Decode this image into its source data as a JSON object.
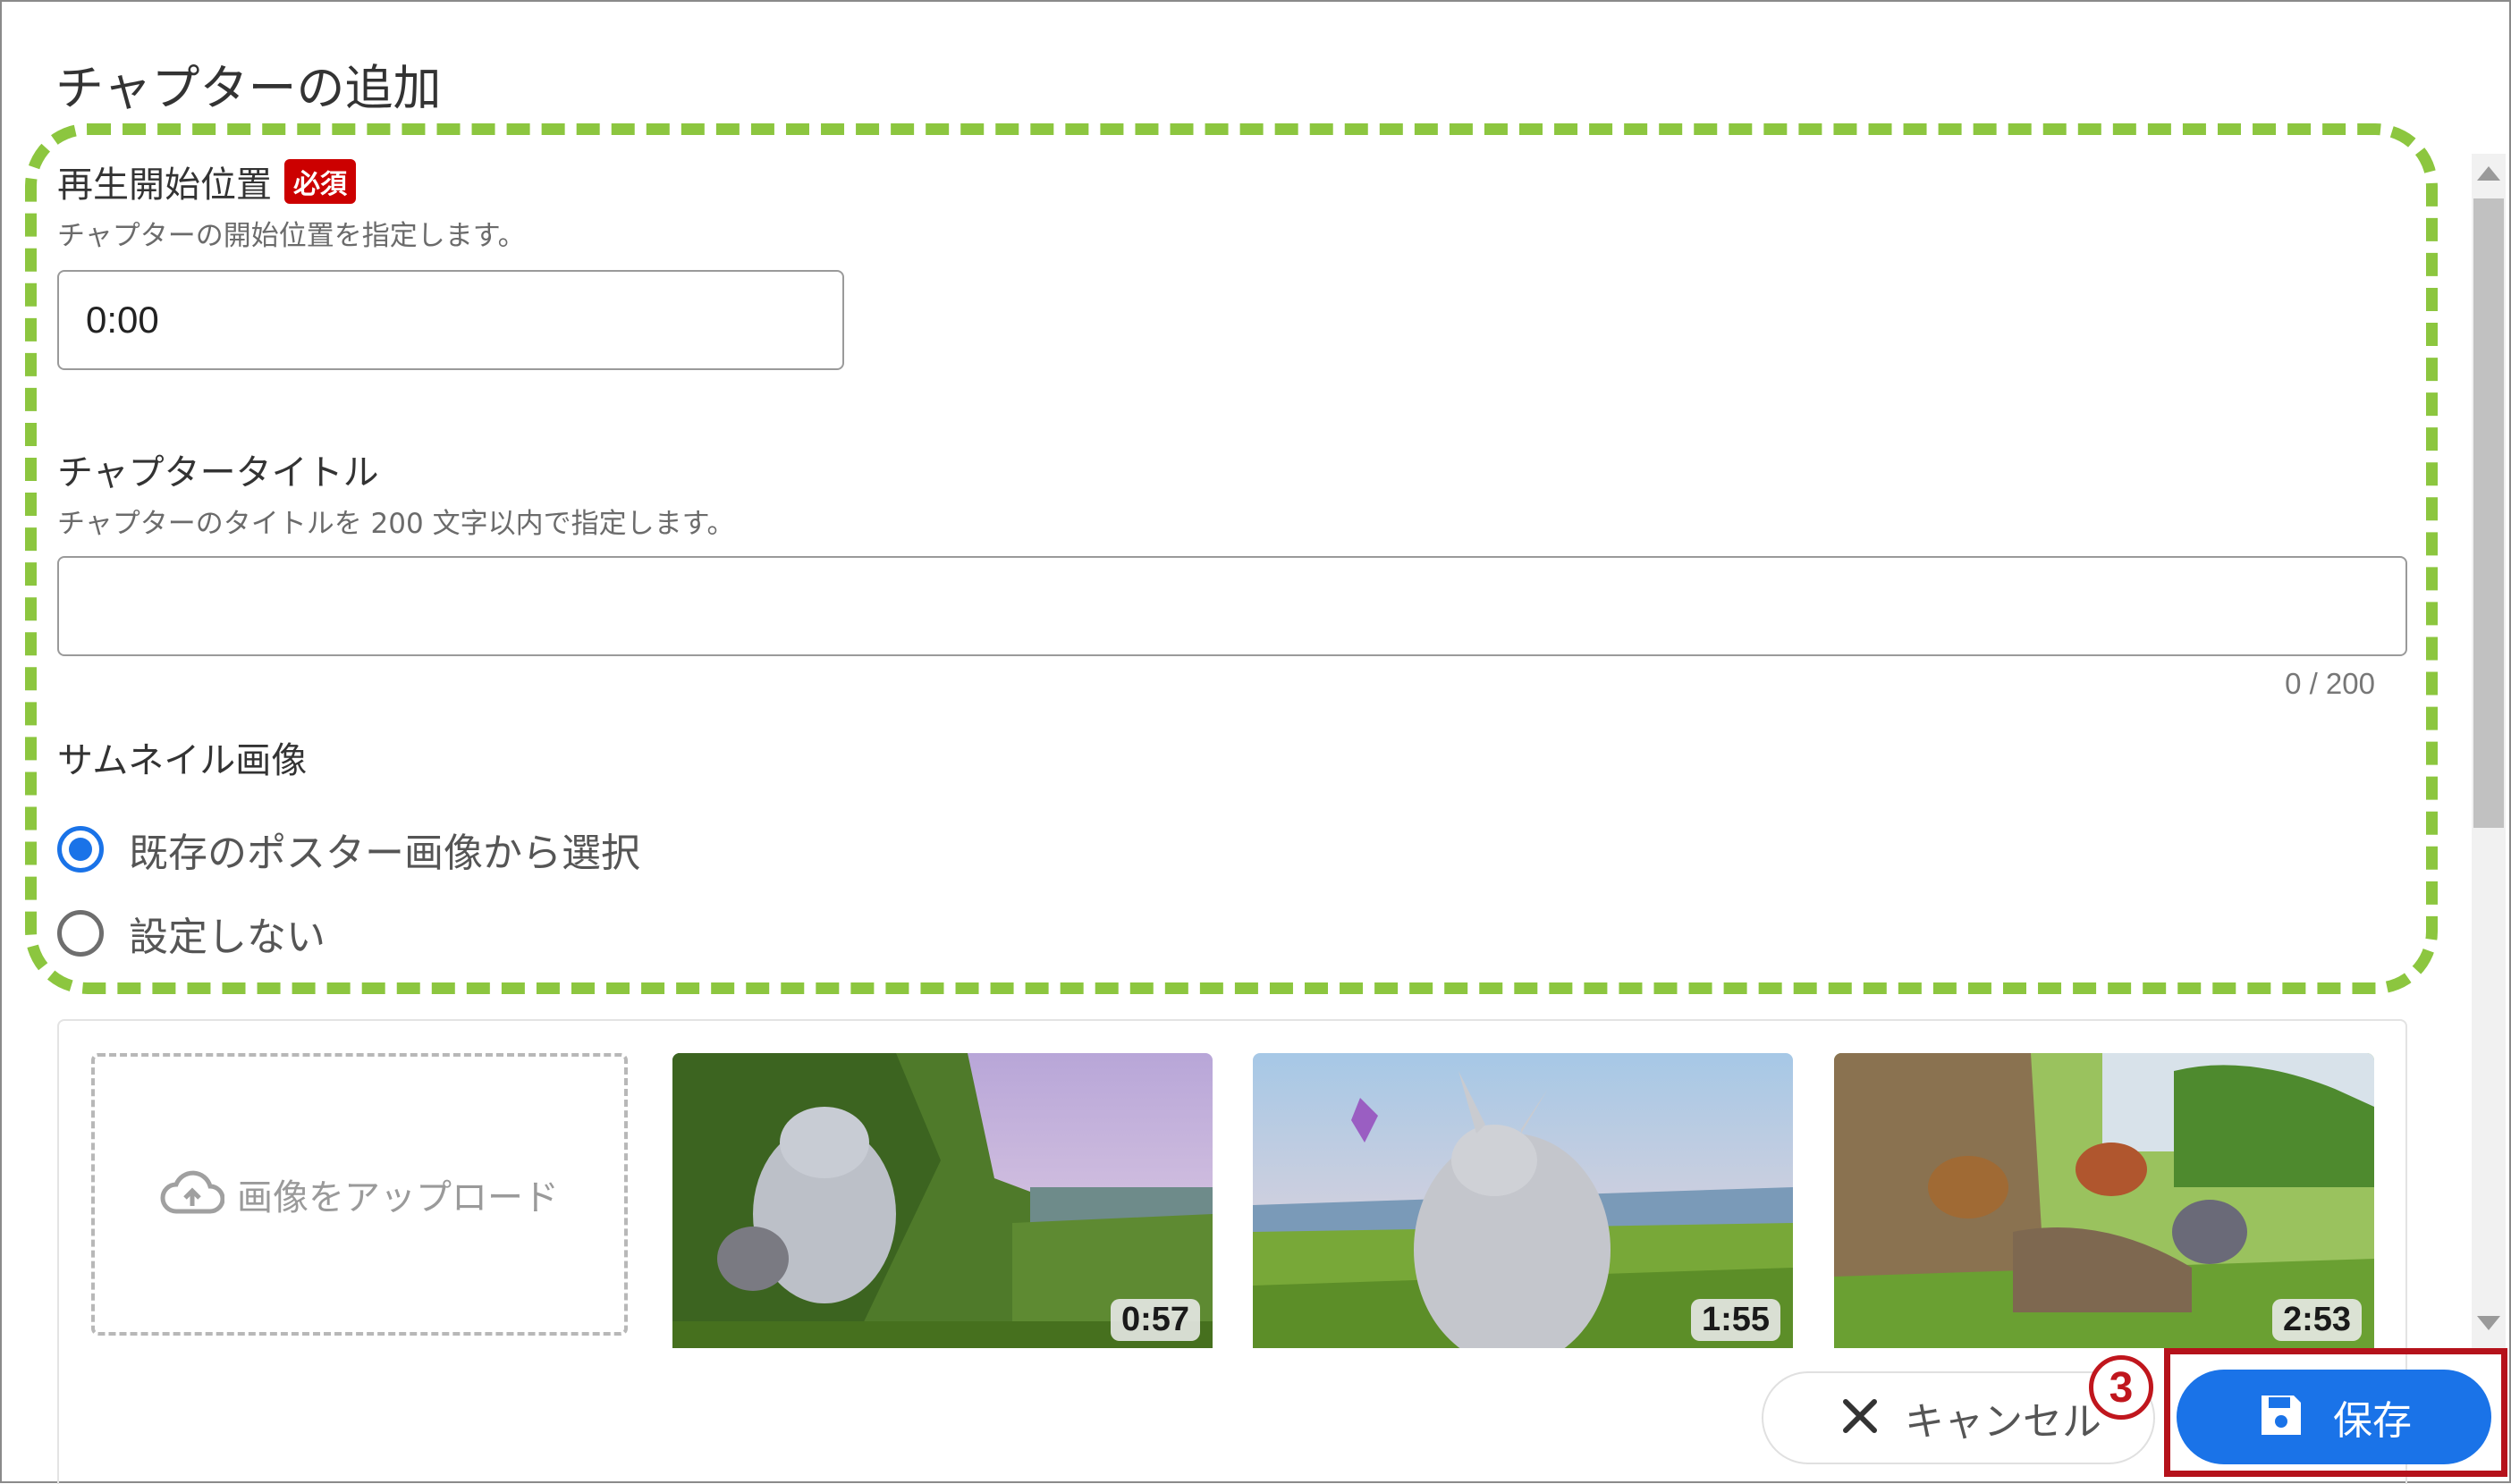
{
  "dialog": {
    "title": "チャプターの追加"
  },
  "start_position": {
    "label": "再生開始位置",
    "required_badge": "必須",
    "help": "チャプターの開始位置を指定します。",
    "value": "0:00"
  },
  "chapter_title": {
    "label": "チャプタータイトル",
    "help": "チャプターのタイトルを 200 文字以内で指定します。",
    "value": "",
    "counter": "0 / 200"
  },
  "thumbnail": {
    "label": "サムネイル画像",
    "options": [
      {
        "label": "既存のポスター画像から選択",
        "selected": true
      },
      {
        "label": "設定しない",
        "selected": false
      }
    ],
    "upload_label": "画像をアップロード",
    "images": [
      {
        "time": "0:57",
        "icon": "thumbnail-image"
      },
      {
        "time": "1:55",
        "icon": "thumbnail-image"
      },
      {
        "time": "2:53",
        "icon": "thumbnail-image"
      }
    ]
  },
  "footer": {
    "cancel_label": "キャンセル",
    "save_label": "保存",
    "step_marker": "3"
  },
  "colors": {
    "accent": "#1a73e8",
    "highlight_dash": "#8cc63f",
    "annotation_red": "#b5121b",
    "required_badge": "#cc0000"
  }
}
